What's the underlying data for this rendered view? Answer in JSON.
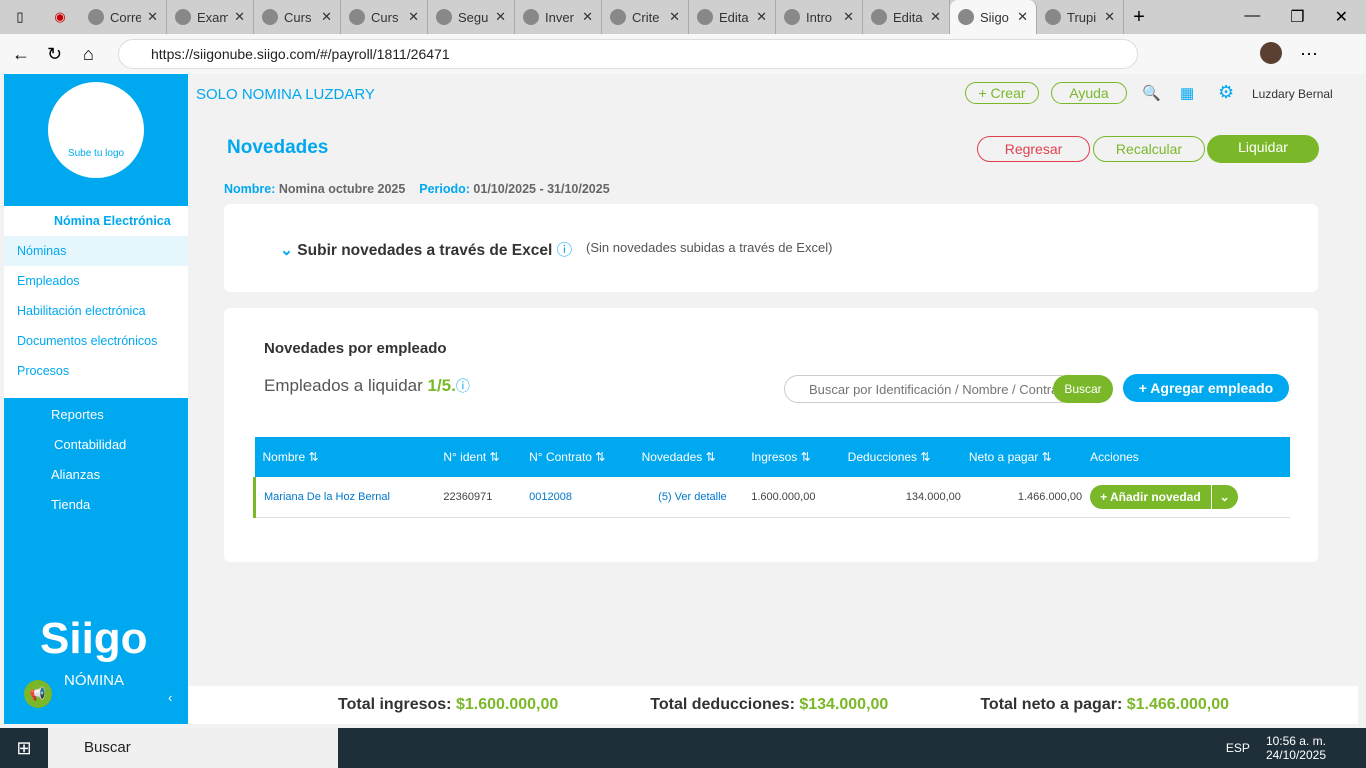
{
  "browser": {
    "tabs": [
      "Corre",
      "Exam",
      "Curs",
      "Curs",
      "Segu",
      "Inver",
      "Crite",
      "Edita",
      "Intro",
      "Edita",
      "Siigo",
      "Trupi"
    ],
    "active_tab": 10,
    "url": "https://siigonube.siigo.com/#/payroll/1811/26471"
  },
  "sidebar": {
    "logo_text": "Sube tu logo",
    "section": "Nómina Electrónica",
    "sub_items": [
      "Nóminas",
      "Empleados",
      "Habilitación electrónica",
      "Documentos electrónicos",
      "Procesos"
    ],
    "items": [
      "Reportes",
      "Contabilidad",
      "Alianzas",
      "Tienda"
    ],
    "brand": "Siigo",
    "brand_sub": "NÓMINA"
  },
  "topbar": {
    "company": "SOLO NOMINA LUZDARY",
    "crear": "+ Crear",
    "ayuda": "Ayuda",
    "user": "Luzdary Bernal"
  },
  "page": {
    "title": "Novedades",
    "regresar": "Regresar",
    "recalcular": "Recalcular",
    "liquidar": "Liquidar",
    "nombre_label": "Nombre:",
    "nombre": "Nomina octubre 2025",
    "periodo_label": "Periodo:",
    "periodo": "01/10/2025 - 31/10/2025"
  },
  "excel": {
    "title": "Subir novedades a través de Excel",
    "note": "(Sin novedades subidas a través de Excel)"
  },
  "empleados": {
    "title": "Novedades por empleado",
    "count_label": "Empleados a liquidar",
    "count": "1/5.",
    "search_placeholder": "Buscar por Identificación / Nombre / Contrato",
    "buscar": "Buscar",
    "agregar": "+ Agregar empleado",
    "columns": [
      "Nombre",
      "N° ident",
      "N° Contrato",
      "Novedades",
      "Ingresos",
      "Deducciones",
      "Neto a pagar",
      "Acciones"
    ],
    "rows": [
      {
        "nombre": "Mariana De la Hoz Bernal",
        "ident": "22360971",
        "contrato": "0012008",
        "novedades": "(5) Ver detalle",
        "ingresos": "1.600.000,00",
        "deducciones": "134.000,00",
        "neto": "1.466.000,00",
        "accion": "+ Añadir novedad"
      }
    ]
  },
  "footer": {
    "ingresos_label": "Total ingresos:",
    "ingresos": "$1.600.000,00",
    "deducciones_label": "Total deducciones:",
    "deducciones": "$134.000,00",
    "neto_label": "Total neto a pagar:",
    "neto": "$1.466.000,00"
  },
  "taskbar": {
    "search": "Buscar",
    "lang": "ESP",
    "time": "10:56 a. m.",
    "date": "24/10/2025"
  }
}
